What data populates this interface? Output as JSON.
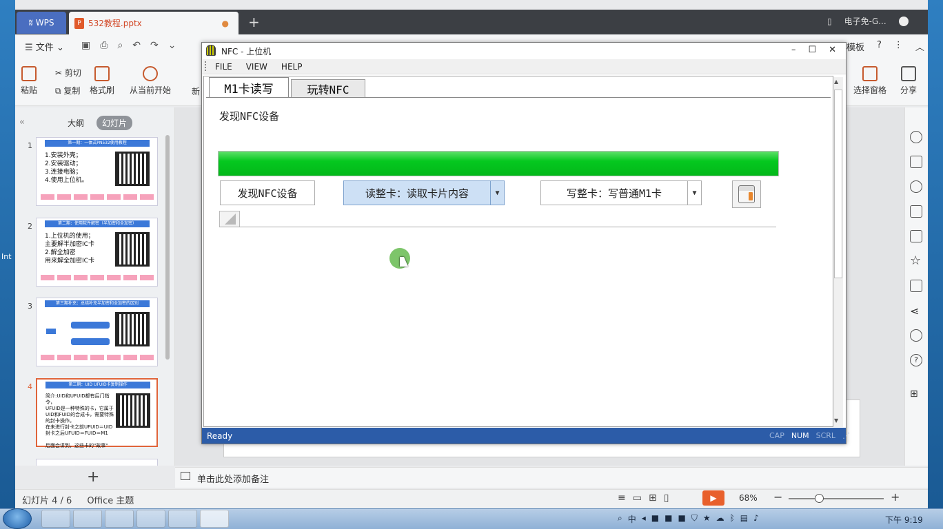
{
  "wps": {
    "home_tab": "WPS",
    "doc_tab": "532教程.pptx",
    "top_right_user": "电子免-G...",
    "menu_file": "文件",
    "menu_right": [
      "模板",
      "?"
    ],
    "ribbon": {
      "paste": "粘贴",
      "cut": "剪切",
      "copy": "复制",
      "format_brush": "格式刷",
      "from_current": "从当前开始",
      "new": "新",
      "selection_pane": "选择窗格",
      "share": "分享"
    },
    "panel_tabs": [
      "大纲",
      "幻灯片"
    ],
    "slides": [
      {
        "num": "1",
        "head": "第一期：一体式PN532使用教程",
        "text": "1.安装外壳；\n2.安装驱动；\n3.连接电脑；\n4.使用上位机。"
      },
      {
        "num": "2",
        "head": "第二期：使用软件解密（半加密和全加密）",
        "text": "1.上位机的使用；\n  主要解半加密IC卡\n2.解全加密\n  用来解全加密IC卡"
      },
      {
        "num": "3",
        "head": "第三期补充：总结补充半加密和全加密的区别",
        "text": ""
      },
      {
        "num": "4",
        "head": "第三期：UID UFUID卡复制操作",
        "text": "简介:UID和UFUID都有后门指令，\nUFUID是一种特殊的卡，它属于\nUID和FUID的合成卡，需要特殊\n的封卡操作。\n在未进行封卡之前UFUID＝UID\n封卡之后UFUID＝FUID＝M1\n\n后面会讲到，这些卡的\"故事\""
      }
    ],
    "notes_placeholder": "单击此处添加备注",
    "status": {
      "slide_count": "幻灯片 4 / 6",
      "theme": "Office 主题",
      "zoom": "68%"
    }
  },
  "nfc": {
    "title": "NFC - 上位机",
    "menu": [
      "FILE",
      "VIEW",
      "HELP"
    ],
    "tabs": [
      "M1卡读写",
      "玩转NFC"
    ],
    "found_label": "发现NFC设备",
    "progress": 1.0,
    "btn_find": "发现NFC设备",
    "btn_read": "读整卡：读取卡片内容",
    "btn_write": "写整卡：写普通M1卡",
    "status_ready": "Ready",
    "status_keys": [
      "CAP",
      "NUM",
      "SCRL"
    ]
  },
  "taskbar": {
    "clock": "下午 9:19",
    "ime": "中"
  },
  "desktop": {
    "left_label": "Int"
  },
  "colors": {
    "wps_accent": "#e0643a",
    "nfc_status": "#2c5ca8",
    "progress_green": "#05c81f"
  }
}
